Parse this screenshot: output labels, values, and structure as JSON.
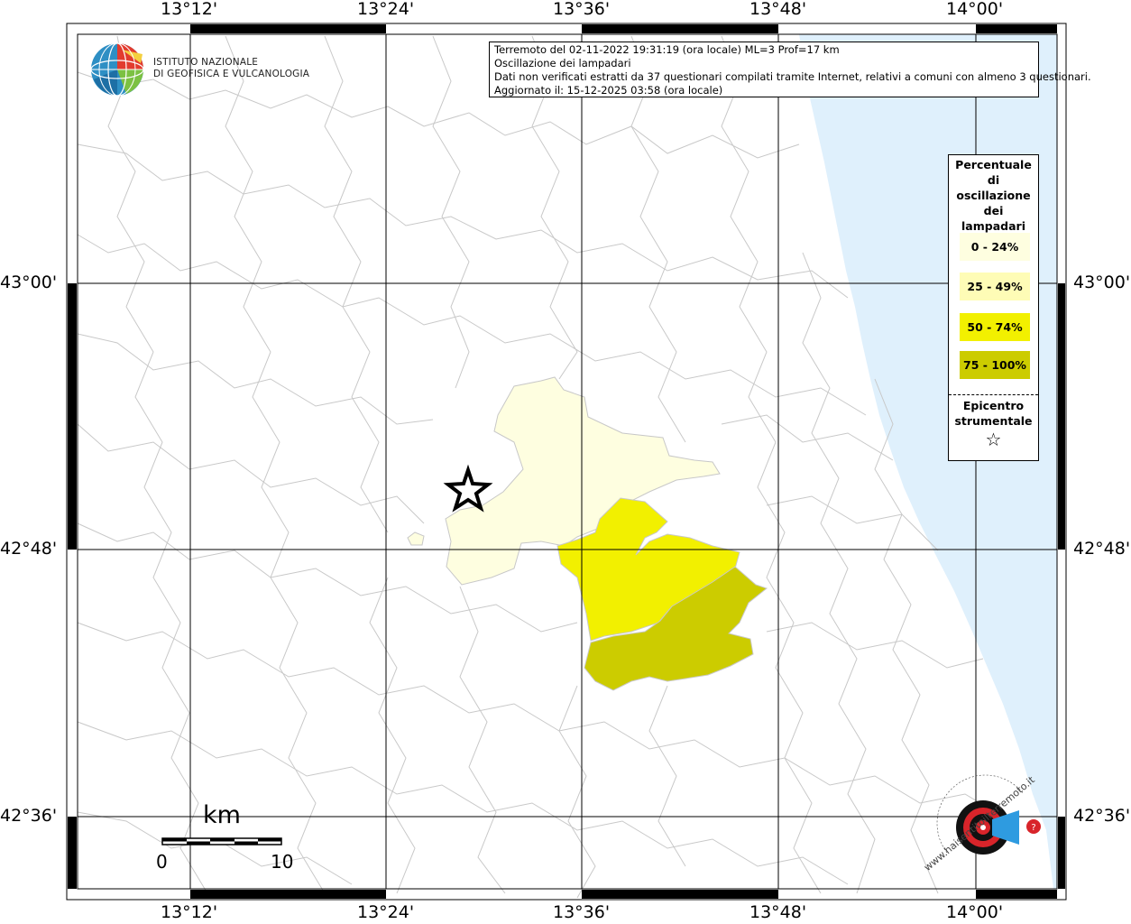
{
  "info_box": {
    "line1": "Terremoto del 02-11-2022 19:31:19 (ora locale) ML=3 Prof=17 km",
    "line2": "Oscillazione dei lampadari",
    "line3": "Dati non verificati estratti da 37 questionari compilati tramite Internet, relativi a comuni con almeno 3 questionari.",
    "line4": "Aggiornato il: 15-12-2025 03:58 (ora locale)"
  },
  "institute": {
    "line1": "ISTITUTO NAZIONALE",
    "line2": "DI GEOFISICA E VULCANOLOGIA"
  },
  "legend": {
    "title": "Percentuale di oscillazione dei lampadari",
    "items": [
      {
        "label": "0 - 24%",
        "color": "#fefee0"
      },
      {
        "label": "25 - 49%",
        "color": "#fefcb6"
      },
      {
        "label": "50 - 74%",
        "color": "#f2f000"
      },
      {
        "label": "75 - 100%",
        "color": "#cccc00"
      }
    ],
    "epicenter_label": "Epicentro strumentale",
    "epicenter_symbol": "☆"
  },
  "axes": {
    "top": [
      "13°12'",
      "13°24'",
      "13°36'",
      "13°48'",
      "14°00'"
    ],
    "bottom": [
      "13°12'",
      "13°24'",
      "13°36'",
      "13°48'",
      "14°00'"
    ],
    "left": [
      "43°00'",
      "42°48'",
      "42°36'"
    ],
    "right": [
      "43°00'",
      "42°48'",
      "42°36'"
    ]
  },
  "scale_bar": {
    "unit": "km",
    "min": "0",
    "max": "10"
  },
  "watermark": {
    "text": "www.haisentitoilterremoto.it"
  },
  "colors": {
    "sea": "#dff0fc",
    "border_lines": "#c8c8c8",
    "grid": "#000000"
  }
}
